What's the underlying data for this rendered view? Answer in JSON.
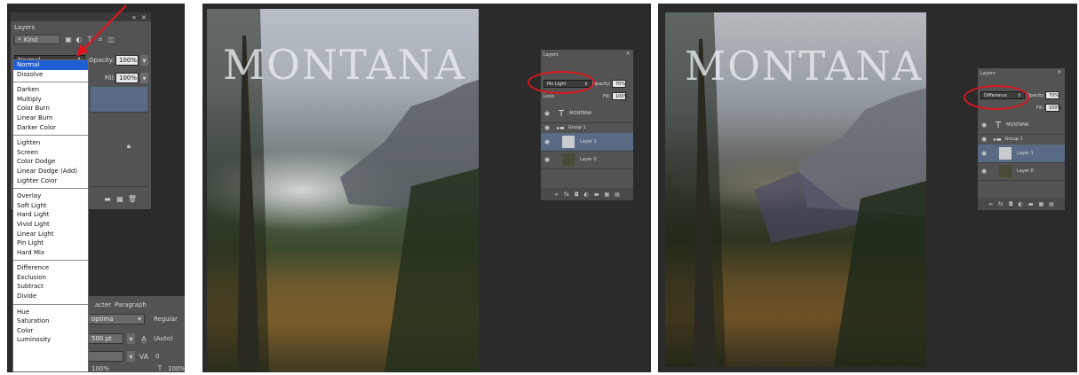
{
  "left": {
    "panel_tab": "Layers",
    "kind_label": "Kind",
    "blend_value": "Normal",
    "opacity_label": "Opacity:",
    "opacity_value": "100%",
    "fill_label": "Fill:",
    "fill_value": "100%",
    "menu_groups": [
      [
        "Normal",
        "Dissolve"
      ],
      [
        "Darken",
        "Multiply",
        "Color Burn",
        "Linear Burn",
        "Darker Color"
      ],
      [
        "Lighten",
        "Screen",
        "Color Dodge",
        "Linear Dodge (Add)",
        "Lighter Color"
      ],
      [
        "Overlay",
        "Soft Light",
        "Hard Light",
        "Vivid Light",
        "Linear Light",
        "Pin Light",
        "Hard Mix"
      ],
      [
        "Difference",
        "Exclusion",
        "Subtract",
        "Divide"
      ],
      [
        "Hue",
        "Saturation",
        "Color",
        "Luminosity"
      ]
    ],
    "selected_item": "Normal",
    "char_tab": "Character",
    "char_tab_visible": "acter",
    "para_tab": "Paragraph",
    "font_family_visible": "optima",
    "font_style": "Regular",
    "font_size": "500 pt",
    "leading": "(Auto)",
    "tracking": "0",
    "scale_v": "100%",
    "scale_h": "100%"
  },
  "middle": {
    "title_text": "MONTANA",
    "panel_tab": "Layers",
    "blend_value": "Pin Light",
    "opacity_label": "Opacity:",
    "opacity_value": "70%",
    "fill_label": "Fill:",
    "fill_value": "100%",
    "lock_label": "Lock:",
    "layers": [
      "MONTANA",
      "Group 1",
      "Layer 1",
      "Layer 0"
    ]
  },
  "right": {
    "title_text": "MONTANA",
    "panel_tab": "Layers",
    "blend_value": "Difference",
    "opacity_label": "Opacity:",
    "opacity_value": "70%",
    "fill_label": "Fill:",
    "fill_value": "100%",
    "layers": [
      "MONTANA",
      "Group 1",
      "Layer 1",
      "Layer 0"
    ]
  },
  "colors": {
    "highlight_oval": "#e0141c",
    "menu_selection": "#1f5fd6",
    "panel": "#535353",
    "workspace": "#2b2b2b"
  }
}
